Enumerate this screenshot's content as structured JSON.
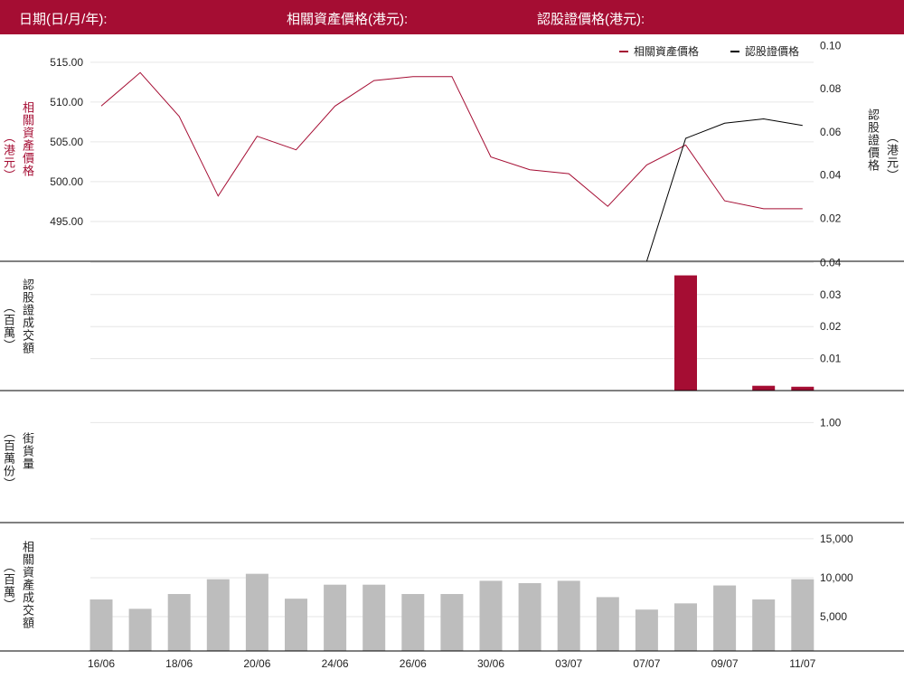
{
  "header": {
    "date_label": "日期(日/月/年):",
    "underlying_label": "相關資產價格(港元):",
    "warrant_label": "認股證價格(港元):"
  },
  "colors": {
    "accent": "#a50d33",
    "warrant_line": "#000000",
    "grey_bar": "#bdbdbd",
    "grid": "#e6e6e6"
  },
  "panels": {
    "price": {
      "left_axis_title": "相關資產價格",
      "left_axis_unit": "（港元）",
      "right_axis_title": "認股證價格",
      "right_axis_unit": "（港元）"
    },
    "warrant_turnover": {
      "axis_title": "認股證成交額",
      "axis_unit": "（百萬）"
    },
    "street_stock": {
      "axis_title": "街貨量",
      "axis_unit": "（百萬份）"
    },
    "underlying_turnover": {
      "axis_title": "相關資產成交額",
      "axis_unit": "（百萬）"
    }
  },
  "chart_data": [
    {
      "type": "line",
      "legend": [
        "相關資產價格",
        "認股證價格"
      ],
      "legend_placement": "top-right",
      "x": [
        "16/06",
        "17/06",
        "18/06",
        "19/06",
        "20/06",
        "23/06",
        "24/06",
        "25/06",
        "26/06",
        "27/06",
        "30/06",
        "02/07",
        "03/07",
        "04/07",
        "07/07",
        "08/07",
        "09/07",
        "10/07",
        "11/07"
      ],
      "series": [
        {
          "name": "相關資產價格",
          "axis": "left",
          "values": [
            509.5,
            513.7,
            508.2,
            498.2,
            505.7,
            504.0,
            509.5,
            512.7,
            513.2,
            513.2,
            503.1,
            501.5,
            501.0,
            496.9,
            502.1,
            504.6,
            497.6,
            496.6,
            496.6
          ]
        },
        {
          "name": "認股證價格",
          "axis": "right",
          "values": [
            null,
            null,
            null,
            null,
            null,
            null,
            null,
            null,
            null,
            null,
            null,
            null,
            null,
            null,
            0.0,
            0.057,
            0.064,
            0.066,
            0.063
          ]
        }
      ],
      "ylim_left": [
        490,
        518.5
      ],
      "yticks_left": [
        "515.00",
        "510.00",
        "505.00",
        "500.00",
        "495.00"
      ],
      "ylim_right": [
        0.0,
        0.1052
      ],
      "yticks_right": [
        "0.10",
        "0.08",
        "0.06",
        "0.04",
        "0.02"
      ],
      "grid": true
    },
    {
      "type": "bar",
      "x": [
        "16/06",
        "17/06",
        "18/06",
        "19/06",
        "20/06",
        "23/06",
        "24/06",
        "25/06",
        "26/06",
        "27/06",
        "30/06",
        "02/07",
        "03/07",
        "04/07",
        "07/07",
        "08/07",
        "09/07",
        "10/07",
        "11/07"
      ],
      "values": [
        0,
        0,
        0,
        0,
        0,
        0,
        0,
        0,
        0,
        0,
        0,
        0,
        0,
        0,
        0,
        0.036,
        0,
        0.0015,
        0.0012
      ],
      "ylim": [
        0,
        0.0404
      ],
      "yticks": [
        "0.04",
        "0.03",
        "0.02",
        "0.01"
      ],
      "grid": true
    },
    {
      "type": "line",
      "x": [
        "16/06",
        "17/06",
        "18/06",
        "19/06",
        "20/06",
        "23/06",
        "24/06",
        "25/06",
        "26/06",
        "27/06",
        "30/06",
        "02/07",
        "03/07",
        "04/07",
        "07/07",
        "08/07",
        "09/07",
        "10/07",
        "11/07"
      ],
      "values": [],
      "ylim": [
        0,
        1.2
      ],
      "yticks": [
        "1.00"
      ],
      "grid": true
    },
    {
      "type": "bar",
      "x": [
        "16/06",
        "17/06",
        "18/06",
        "19/06",
        "20/06",
        "23/06",
        "24/06",
        "25/06",
        "26/06",
        "27/06",
        "30/06",
        "02/07",
        "03/07",
        "04/07",
        "07/07",
        "08/07",
        "09/07",
        "10/07",
        "11/07"
      ],
      "values": [
        7200,
        6000,
        7900,
        9800,
        10500,
        7300,
        9100,
        9100,
        7900,
        7900,
        9600,
        9300,
        9600,
        7500,
        5900,
        6700,
        9000,
        7200,
        9800
      ],
      "ylim": [
        0,
        16500
      ],
      "yticks": [
        "15,000",
        "10,000",
        "5,000"
      ],
      "xtick_labels": [
        "16/06",
        "18/06",
        "20/06",
        "24/06",
        "26/06",
        "30/06",
        "03/07",
        "07/07",
        "09/07",
        "11/07"
      ],
      "grid": true
    }
  ]
}
